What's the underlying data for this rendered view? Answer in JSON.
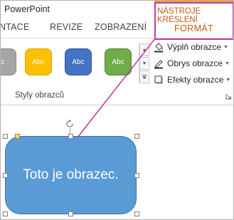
{
  "app": {
    "title": "PowerPoint"
  },
  "tabs": {
    "animace": "NTACE",
    "revize": "REVIZE",
    "zobrazeni": "ZOBRAZENÍ"
  },
  "context_tab": {
    "group_label": "NÁSTROJE KRESLENÍ",
    "tab_label": "FORMÁT",
    "accent": "#e8a033",
    "highlight_color": "#bd3fa6"
  },
  "styles_gallery": {
    "group_label": "Styly obrazců",
    "swatches": [
      {
        "label": "c",
        "color": "#a5a5a5"
      },
      {
        "label": "Abc",
        "color": "#ffc000"
      },
      {
        "label": "Abc",
        "color": "#4472c4"
      },
      {
        "label": "Abc",
        "color": "#70ad47"
      }
    ]
  },
  "commands": {
    "fill": "Výplň obrazce",
    "outline": "Obrys obrazce",
    "effects": "Efekty obrazce"
  },
  "shape": {
    "text": "Toto je obrazec.",
    "fill": "#5b9bd5"
  }
}
